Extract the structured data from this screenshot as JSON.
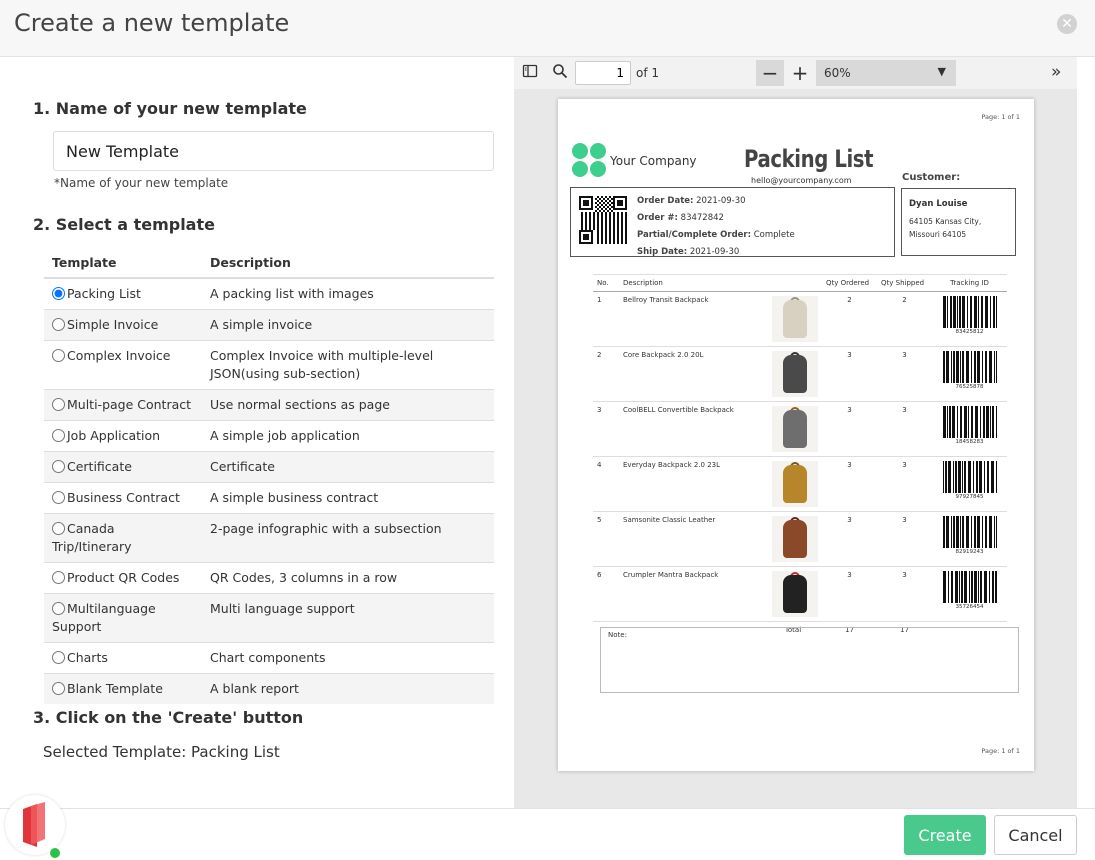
{
  "dialog": {
    "title": "Create a new template"
  },
  "step1": {
    "title": "1. Name of your new template",
    "input_value": "New Template",
    "hint": "*Name of your new template"
  },
  "step2": {
    "title": "2. Select a template",
    "col_template": "Template",
    "col_description": "Description",
    "selected_index": 0,
    "templates": [
      {
        "name": "Packing List",
        "description": "A packing list with images"
      },
      {
        "name": "Simple Invoice",
        "description": "A simple invoice"
      },
      {
        "name": "Complex Invoice",
        "description": "Complex Invoice with multiple-level JSON(using sub-section)"
      },
      {
        "name": "Multi-page Contract",
        "description": "Use normal sections as page"
      },
      {
        "name": "Job Application",
        "description": "A simple job application"
      },
      {
        "name": "Certificate",
        "description": "Certificate"
      },
      {
        "name": "Business Contract",
        "description": "A simple business contract"
      },
      {
        "name": "Canada Trip/Itinerary",
        "description": "2-page infographic with a subsection"
      },
      {
        "name": "Product QR Codes",
        "description": "QR Codes, 3 columns in a row"
      },
      {
        "name": "Multilanguage Support",
        "description": "Multi language support"
      },
      {
        "name": "Charts",
        "description": "Chart components"
      },
      {
        "name": "Blank Template",
        "description": "A blank report"
      }
    ]
  },
  "step3": {
    "title": "3. Click on the 'Create' button",
    "selected_text": "Selected Template: Packing List"
  },
  "viewer": {
    "page_value": "1",
    "page_of": "of 1",
    "zoom": "60%",
    "zoom_out": "−",
    "zoom_in": "+",
    "more": "»"
  },
  "preview": {
    "page_label": "Page: 1 of 1",
    "company": "Your Company",
    "title": "Packing List",
    "email": "hello@yourcompany.com",
    "customer_label": "Customer:",
    "order": {
      "date_label": "Order Date:",
      "date": "2021-09-30",
      "num_label": "Order #:",
      "num": "83472842",
      "partial_label": "Partial/Complete Order:",
      "partial": "Complete",
      "ship_label": "Ship Date:",
      "ship": "2021-09-30"
    },
    "customer": {
      "name": "Dyan Louise",
      "addr1": "64105 Kansas City,",
      "addr2": "Missouri 64105"
    },
    "headers": {
      "no": "No.",
      "desc": "Description",
      "qty_ordered": "Qty Ordered",
      "qty_shipped": "Qty Shipped",
      "tracking": "Tracking ID"
    },
    "items": [
      {
        "no": "1",
        "desc": "Bellroy Transit Backpack",
        "ordered": "2",
        "shipped": "2",
        "tracking": "83425812",
        "color": "#d8d0c0",
        "strap": "#9a9080"
      },
      {
        "no": "2",
        "desc": "Core Backpack 2.0 20L",
        "ordered": "3",
        "shipped": "3",
        "tracking": "76525878",
        "color": "#4a4a4a",
        "strap": "#333333"
      },
      {
        "no": "3",
        "desc": "CoolBELL Convertible Backpack",
        "ordered": "3",
        "shipped": "3",
        "tracking": "18458283",
        "color": "#6e6e6e",
        "strap": "#9c5a2a"
      },
      {
        "no": "4",
        "desc": "Everyday Backpack 2.0 23L",
        "ordered": "3",
        "shipped": "3",
        "tracking": "97927845",
        "color": "#b8862a",
        "strap": "#7a5a1a"
      },
      {
        "no": "5",
        "desc": "Samsonite Classic Leather",
        "ordered": "3",
        "shipped": "3",
        "tracking": "82919243",
        "color": "#8a4a2a",
        "strap": "#5a2a1a"
      },
      {
        "no": "6",
        "desc": "Crumpler   Mantra Backpack",
        "ordered": "3",
        "shipped": "3",
        "tracking": "35726454",
        "color": "#222222",
        "strap": "#c03030"
      }
    ],
    "total_label": "Total",
    "total_ordered": "17",
    "total_shipped": "17",
    "note_label": "Note:"
  },
  "footer": {
    "create": "Create",
    "cancel": "Cancel"
  },
  "colors": {
    "accent": "#4ac98c",
    "logo": "#3ecf8e",
    "brand_red": "#e0353b",
    "online": "#2bc24b"
  }
}
